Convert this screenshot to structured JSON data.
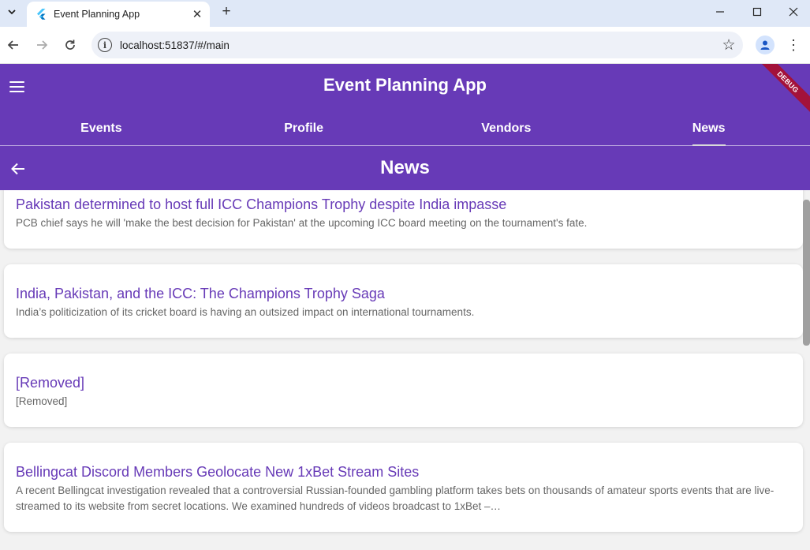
{
  "browser": {
    "tab_title": "Event Planning App",
    "url": "localhost:51837/#/main"
  },
  "app": {
    "title": "Event Planning App",
    "debug_label": "DEBUG",
    "tabs": [
      {
        "label": "Events"
      },
      {
        "label": "Profile"
      },
      {
        "label": "Vendors"
      },
      {
        "label": "News",
        "active": true
      }
    ],
    "page_title": "News",
    "accent_color": "#673ab7"
  },
  "news": [
    {
      "title": "Pakistan determined to host full ICC Champions Trophy despite India impasse",
      "description": "PCB chief says he will 'make the best decision for Pakistan' at the upcoming ICC board meeting on the tournament's fate."
    },
    {
      "title": "India, Pakistan, and the ICC: The Champions Trophy Saga",
      "description": "India’s politicization of its cricket board is having an outsized impact on international tournaments."
    },
    {
      "title": "[Removed]",
      "description": "[Removed]"
    },
    {
      "title": "Bellingcat Discord Members Geolocate New 1xBet Stream Sites",
      "description": "A recent Bellingcat investigation revealed that a controversial Russian-founded gambling platform takes bets on thousands of amateur sports events that are live-streamed to its website from secret locations. We examined hundreds of videos broadcast to 1xBet –…"
    }
  ]
}
